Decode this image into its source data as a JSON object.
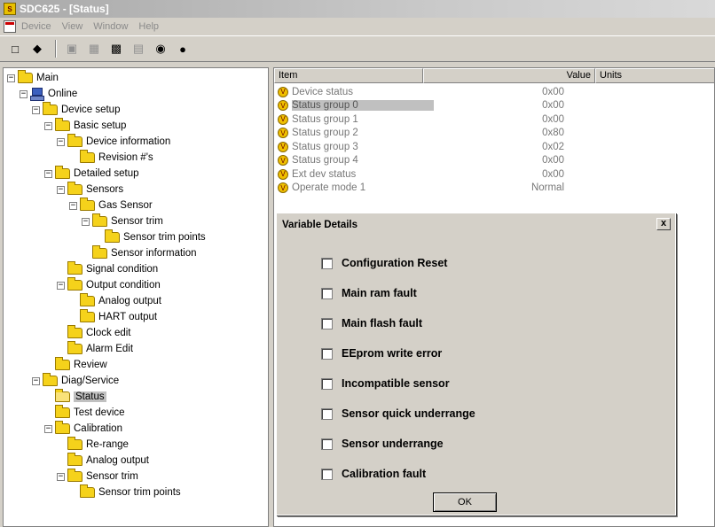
{
  "window": {
    "title": "SDC625 - [Status]"
  },
  "menu": {
    "items": [
      "Device",
      "View",
      "Window",
      "Help"
    ]
  },
  "toolbar": {
    "buttons": [
      "new-icon",
      "help-icon",
      "device-icon",
      "network-icon",
      "read-icon",
      "write-icon",
      "refresh-icon",
      "stop-icon"
    ]
  },
  "tree": {
    "nodes": [
      {
        "label": "Main",
        "depth": 0,
        "toggle": "−",
        "icon": "folder"
      },
      {
        "label": "Online",
        "depth": 1,
        "toggle": "−",
        "icon": "network"
      },
      {
        "label": "Device setup",
        "depth": 2,
        "toggle": "−",
        "icon": "folder"
      },
      {
        "label": "Basic setup",
        "depth": 3,
        "toggle": "−",
        "icon": "folder"
      },
      {
        "label": "Device information",
        "depth": 4,
        "toggle": "−",
        "icon": "folder"
      },
      {
        "label": "Revision #'s",
        "depth": 5,
        "toggle": "",
        "icon": "folder"
      },
      {
        "label": "Detailed setup",
        "depth": 3,
        "toggle": "−",
        "icon": "folder"
      },
      {
        "label": "Sensors",
        "depth": 4,
        "toggle": "−",
        "icon": "folder"
      },
      {
        "label": "Gas Sensor",
        "depth": 5,
        "toggle": "−",
        "icon": "folder"
      },
      {
        "label": "Sensor trim",
        "depth": 6,
        "toggle": "−",
        "icon": "folder"
      },
      {
        "label": "Sensor trim points",
        "depth": 7,
        "toggle": "",
        "icon": "folder"
      },
      {
        "label": "Sensor information",
        "depth": 6,
        "toggle": "",
        "icon": "folder"
      },
      {
        "label": "Signal condition",
        "depth": 4,
        "toggle": "",
        "icon": "folder"
      },
      {
        "label": "Output condition",
        "depth": 4,
        "toggle": "−",
        "icon": "folder"
      },
      {
        "label": "Analog output",
        "depth": 5,
        "toggle": "",
        "icon": "folder"
      },
      {
        "label": "HART output",
        "depth": 5,
        "toggle": "",
        "icon": "folder"
      },
      {
        "label": "Clock edit",
        "depth": 4,
        "toggle": "",
        "icon": "folder"
      },
      {
        "label": "Alarm Edit",
        "depth": 4,
        "toggle": "",
        "icon": "folder"
      },
      {
        "label": "Review",
        "depth": 3,
        "toggle": "",
        "icon": "folder"
      },
      {
        "label": "Diag/Service",
        "depth": 2,
        "toggle": "−",
        "icon": "folder"
      },
      {
        "label": "Status",
        "depth": 3,
        "toggle": "",
        "icon": "folder-open",
        "selected": true
      },
      {
        "label": "Test device",
        "depth": 3,
        "toggle": "",
        "icon": "folder"
      },
      {
        "label": "Calibration",
        "depth": 3,
        "toggle": "−",
        "icon": "folder"
      },
      {
        "label": "Re-range",
        "depth": 4,
        "toggle": "",
        "icon": "folder"
      },
      {
        "label": "Analog output",
        "depth": 4,
        "toggle": "",
        "icon": "folder"
      },
      {
        "label": "Sensor trim",
        "depth": 4,
        "toggle": "−",
        "icon": "folder"
      },
      {
        "label": "Sensor trim points",
        "depth": 5,
        "toggle": "",
        "icon": "folder"
      }
    ]
  },
  "list": {
    "columns": [
      "Item",
      "Value",
      "Units"
    ],
    "rows": [
      {
        "item": "Device status",
        "value": "0x00"
      },
      {
        "item": "Status group 0",
        "value": "0x00",
        "selected": true
      },
      {
        "item": "Status group 1",
        "value": "0x00"
      },
      {
        "item": "Status group 2",
        "value": "0x80"
      },
      {
        "item": "Status group 3",
        "value": "0x02"
      },
      {
        "item": "Status group 4",
        "value": "0x00"
      },
      {
        "item": "Ext dev status",
        "value": "0x00"
      },
      {
        "item": "Operate mode 1",
        "value": "Normal"
      }
    ]
  },
  "dialog": {
    "title": "Variable Details",
    "close_label": "x",
    "checkboxes": [
      {
        "label": "Configuration Reset",
        "checked": false
      },
      {
        "label": "Main ram fault",
        "checked": false
      },
      {
        "label": "Main flash fault",
        "checked": false
      },
      {
        "label": "EEprom write error",
        "checked": false
      },
      {
        "label": "Incompatible sensor",
        "checked": false
      },
      {
        "label": "Sensor quick underrange",
        "checked": false
      },
      {
        "label": "Sensor underrange",
        "checked": false
      },
      {
        "label": "Calibration fault",
        "checked": false
      }
    ],
    "ok_label": "OK"
  }
}
